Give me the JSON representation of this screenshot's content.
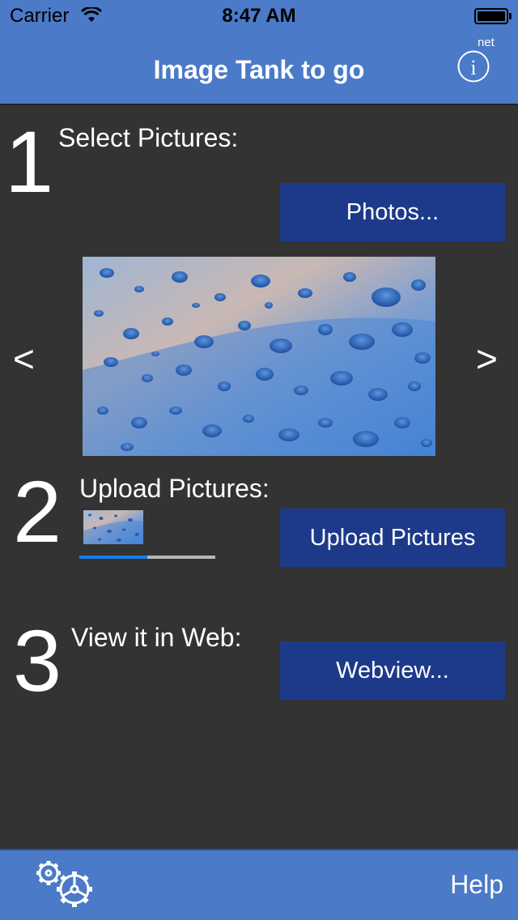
{
  "status_bar": {
    "carrier": "Carrier",
    "time": "8:47 AM"
  },
  "nav": {
    "title": "Image Tank to go",
    "info_badge": "net"
  },
  "step1": {
    "number": "1",
    "label": "Select Pictures:",
    "button": "Photos..."
  },
  "gallery": {
    "prev_label": "<",
    "next_label": ">"
  },
  "step2": {
    "number": "2",
    "label": "Upload Pictures:",
    "button": "Upload Pictures",
    "progress": 0.5
  },
  "step3": {
    "number": "3",
    "label": "View it in Web:",
    "button": "Webview..."
  },
  "toolbar": {
    "help_label": "Help",
    "settings_icon": "gears-icon"
  },
  "colors": {
    "bar": "#4a7ac8",
    "button": "#1d3a8a",
    "background": "#333333",
    "progress": "#1a7ce8"
  }
}
